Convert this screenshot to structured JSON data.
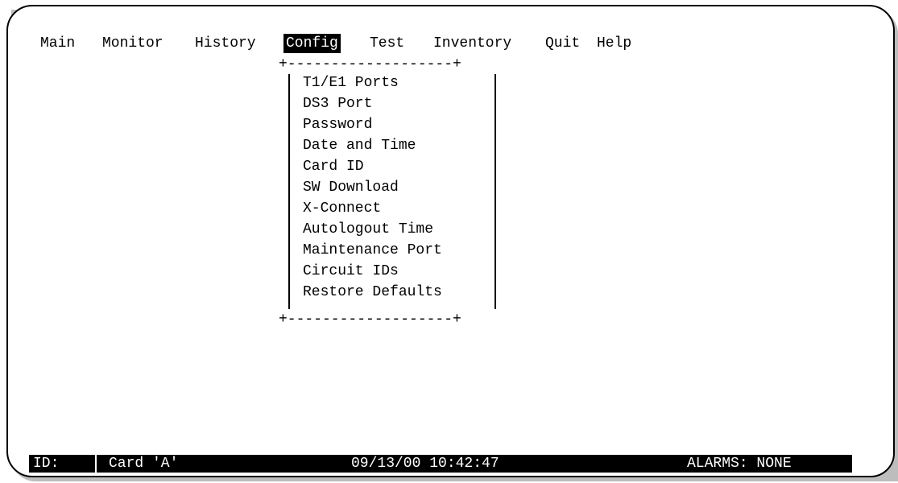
{
  "menubar": {
    "items": [
      {
        "label": "Main",
        "selected": false
      },
      {
        "label": "Monitor",
        "selected": false
      },
      {
        "label": "History",
        "selected": false
      },
      {
        "label": "Config",
        "selected": true
      },
      {
        "label": "Test",
        "selected": false
      },
      {
        "label": "Inventory",
        "selected": false
      },
      {
        "label": "Quit",
        "selected": false
      },
      {
        "label": "Help",
        "selected": false
      }
    ]
  },
  "config_menu": {
    "border_top": "+-------------------+",
    "border_bottom": "+-------------------+",
    "items": [
      "T1/E1 Ports",
      "DS3 Port",
      "Password",
      "Date and Time",
      "Card ID",
      "SW Download",
      "X-Connect",
      "Autologout Time",
      "Maintenance Port",
      "Circuit IDs",
      "Restore Defaults"
    ]
  },
  "statusbar": {
    "id_label": "ID:",
    "card": "Card 'A'",
    "datetime": "09/13/00 10:42:47",
    "alarms": "ALARMS: NONE"
  },
  "colors": {
    "background": "#ffffff",
    "foreground": "#000000",
    "highlight_bg": "#000000",
    "highlight_fg": "#ffffff",
    "shadow": "#bdbdbd"
  }
}
